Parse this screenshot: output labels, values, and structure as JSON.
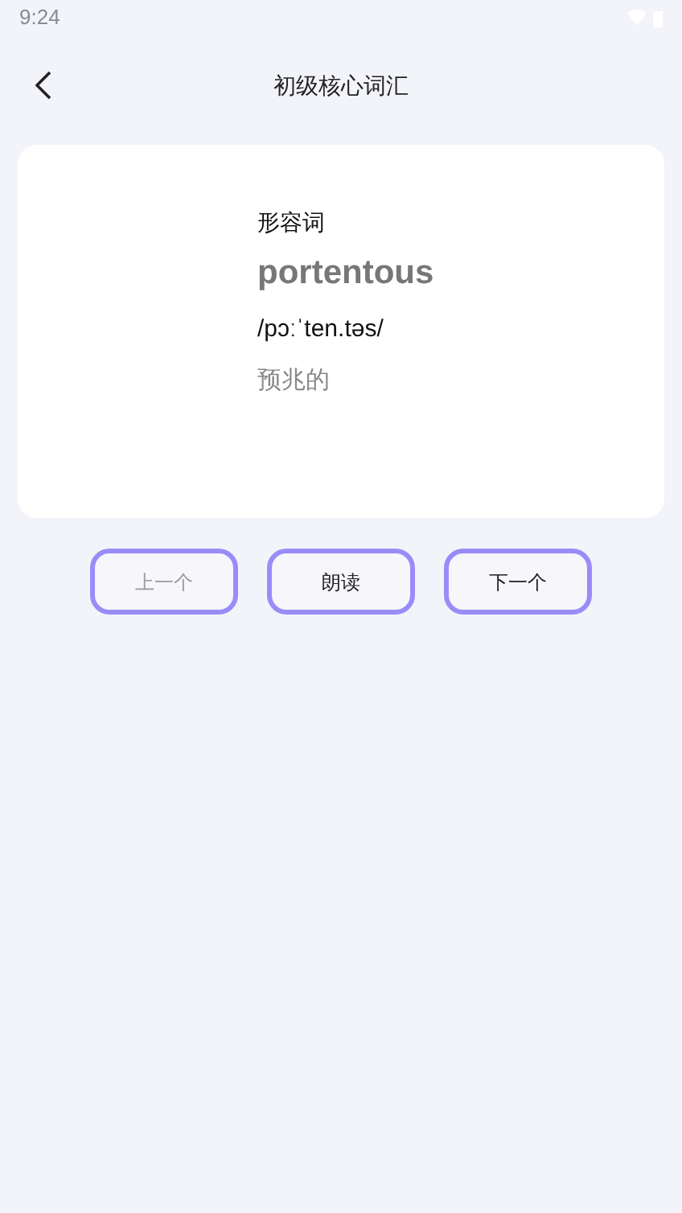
{
  "status_bar": {
    "time": "9:24"
  },
  "header": {
    "title": "初级核心词汇"
  },
  "card": {
    "part_of_speech": "形容词",
    "word": "portentous",
    "phonetic": "/pɔːˈten.təs/",
    "meaning": "预兆的"
  },
  "buttons": [
    {
      "label": "上一个",
      "disabled": true
    },
    {
      "label": "朗读",
      "disabled": false
    },
    {
      "label": "下一个",
      "disabled": false
    }
  ]
}
